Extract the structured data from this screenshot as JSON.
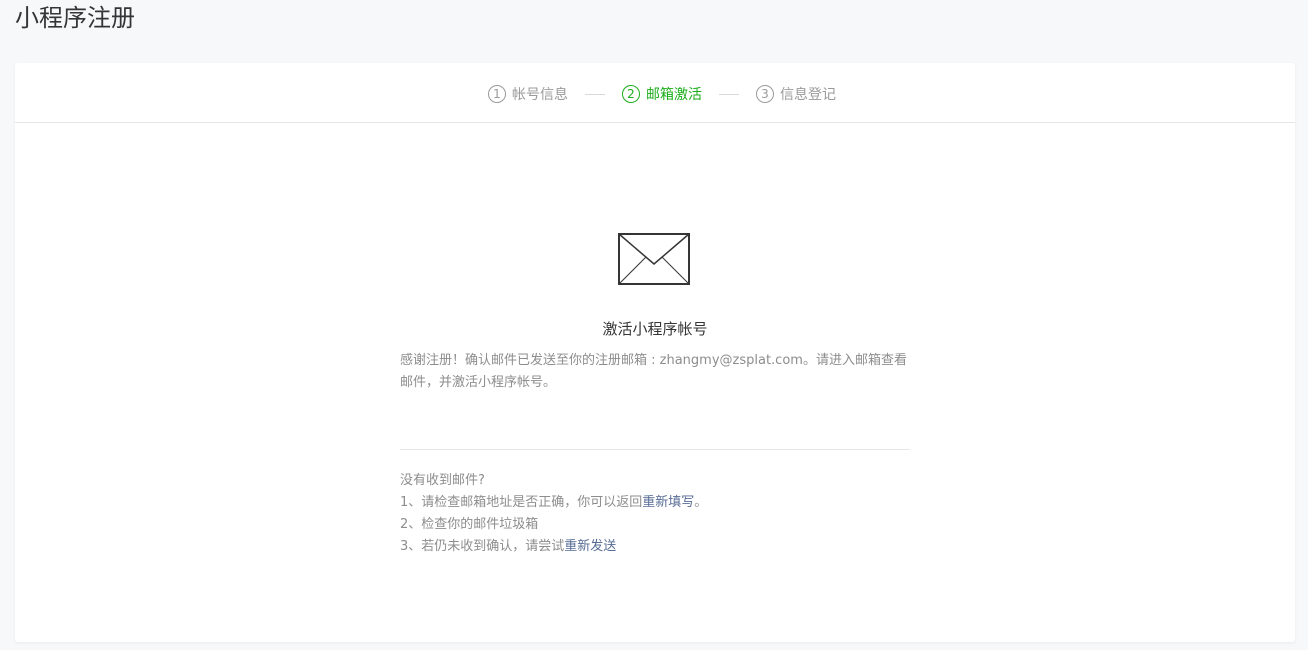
{
  "page": {
    "title": "小程序注册"
  },
  "steps": [
    {
      "num": "1",
      "label": "帐号信息",
      "state": "done"
    },
    {
      "num": "2",
      "label": "邮箱激活",
      "state": "active"
    },
    {
      "num": "3",
      "label": "信息登记",
      "state": "pending"
    }
  ],
  "activation": {
    "title": "激活小程序帐号",
    "description": "感谢注册！确认邮件已发送至你的注册邮箱 : zhangmy@zsplat.com。请进入邮箱查看邮件，并激活小程序帐号。",
    "icon": "envelope-icon"
  },
  "help": {
    "heading": "没有收到邮件?",
    "line1_prefix": "1、请检查邮箱地址是否正确，你可以返回",
    "line1_link": "重新填写",
    "line1_suffix": "。",
    "line2": "2、检查你的邮件垃圾箱",
    "line3_prefix": "3、若仍未收到确认，请尝试",
    "line3_link": "重新发送"
  },
  "colors": {
    "active_step": "#1aad19",
    "link": "#576b95",
    "muted_text": "#8d8d8d",
    "background": "#f7f8fa"
  }
}
